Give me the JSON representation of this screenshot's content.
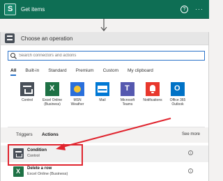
{
  "get_items": {
    "title": "Get items",
    "help_label": "?",
    "more_label": "···"
  },
  "panel": {
    "title": "Choose an operation"
  },
  "search": {
    "placeholder": "Search connectors and actions"
  },
  "tabs": [
    {
      "label": "All",
      "active": true
    },
    {
      "label": "Built-in",
      "active": false
    },
    {
      "label": "Standard",
      "active": false
    },
    {
      "label": "Premium",
      "active": false
    },
    {
      "label": "Custom",
      "active": false
    },
    {
      "label": "My clipboard",
      "active": false
    }
  ],
  "connectors": [
    {
      "label": "Control",
      "icon": "control-icon"
    },
    {
      "label": "Excel Online\n(Business)",
      "icon": "excel-icon"
    },
    {
      "label": "MSN\nWeather",
      "icon": "weather-icon"
    },
    {
      "label": "Mail",
      "icon": "mail-icon"
    },
    {
      "label": "Microsoft\nTeams",
      "icon": "teams-icon"
    },
    {
      "label": "Notifications",
      "icon": "notification-bell-icon"
    },
    {
      "label": "Office 365\nOutlook",
      "icon": "outlook-icon"
    }
  ],
  "subtabs": {
    "triggers": "Triggers",
    "actions": "Actions",
    "see_more": "See more"
  },
  "actions": [
    {
      "title": "Condition",
      "subtitle": "Control",
      "icon": "control-icon"
    },
    {
      "title": "Delete a row",
      "subtitle": "Excel Online (Business)",
      "icon": "excel-icon"
    }
  ],
  "colors": {
    "header_green": "#0e6e54",
    "accent_blue": "#2b73c9",
    "annotation_red": "#e0242e"
  }
}
